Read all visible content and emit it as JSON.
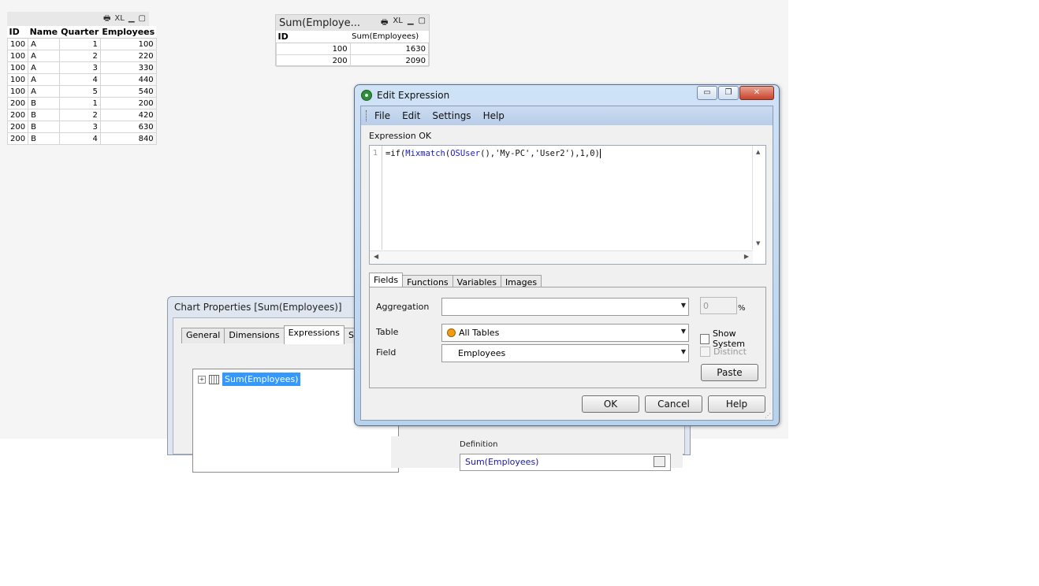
{
  "left_table": {
    "caption_icons": [
      "print-icon",
      "xl-icon",
      "minimize-icon",
      "maximize-icon"
    ],
    "caption_xl": "XL",
    "headers": [
      "ID",
      "Name",
      "Quarter",
      "Employees"
    ],
    "rows": [
      [
        "100",
        "A",
        "1",
        "100"
      ],
      [
        "100",
        "A",
        "2",
        "220"
      ],
      [
        "100",
        "A",
        "3",
        "330"
      ],
      [
        "100",
        "A",
        "4",
        "440"
      ],
      [
        "100",
        "A",
        "5",
        "540"
      ],
      [
        "200",
        "B",
        "1",
        "200"
      ],
      [
        "200",
        "B",
        "2",
        "420"
      ],
      [
        "200",
        "B",
        "3",
        "630"
      ],
      [
        "200",
        "B",
        "4",
        "840"
      ]
    ]
  },
  "sum_chart": {
    "title": "Sum(Employe...",
    "caption_xl": "XL",
    "headers": [
      "ID",
      "Sum(Employees)"
    ],
    "rows": [
      [
        "100",
        "1630"
      ],
      [
        "200",
        "2090"
      ]
    ]
  },
  "chart_properties": {
    "title": "Chart Properties [Sum(Employees)]",
    "tabs": [
      "General",
      "Dimensions",
      "Expressions",
      "Sort"
    ],
    "active_tab": "Expressions",
    "tree_item": "Sum(Employees)",
    "definition_label": "Definition",
    "definition_value": "Sum(Employees)"
  },
  "edit_expression": {
    "title": "Edit Expression",
    "menu": [
      "File",
      "Edit",
      "Settings",
      "Help"
    ],
    "status": "Expression OK",
    "line_number": "1",
    "expression": {
      "p1": "=if(",
      "fn1": "Mixmatch",
      "p2": "(",
      "fn2": "OSUser",
      "p3": "(),'My-PC','User2'),1,0)"
    },
    "tabs": [
      "Fields",
      "Functions",
      "Variables",
      "Images"
    ],
    "active_tab": "Fields",
    "aggregation_label": "Aggregation",
    "aggregation_value": "",
    "percent_value": "0",
    "percent_sign": "%",
    "table_label": "Table",
    "table_value": "All Tables",
    "field_label": "Field",
    "field_value": "Employees",
    "show_system": "Show System",
    "distinct": "Distinct",
    "paste": "Paste",
    "buttons": {
      "ok": "OK",
      "cancel": "Cancel",
      "help": "Help"
    }
  }
}
